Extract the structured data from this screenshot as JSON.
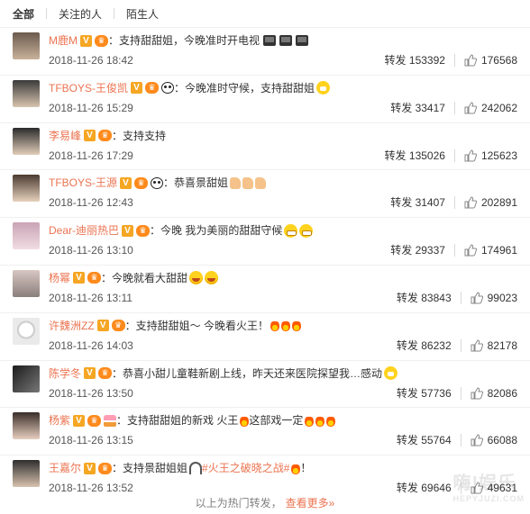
{
  "tabs": [
    "全部",
    "关注的人",
    "陌生人"
  ],
  "repost_label": "转发",
  "rows": [
    {
      "user": "M鹿M",
      "text": "：支持甜甜姐，今晚准时开电视",
      "time": "2018-11-26 18:42",
      "reposts": "153392",
      "likes": "176568"
    },
    {
      "user": "TFBOYS-王俊凯",
      "text": "：今晚准时守候，支持甜甜姐",
      "time": "2018-11-26 15:29",
      "reposts": "33417",
      "likes": "242062"
    },
    {
      "user": "李易峰",
      "text": "：支持支持",
      "time": "2018-11-26 17:29",
      "reposts": "135026",
      "likes": "125623"
    },
    {
      "user": "TFBOYS-王源",
      "text": "：恭喜景甜姐",
      "time": "2018-11-26 12:43",
      "reposts": "31407",
      "likes": "202891"
    },
    {
      "user": "Dear-迪丽热巴",
      "text": "：今晚 我为美丽的甜甜守候",
      "time": "2018-11-26 13:10",
      "reposts": "29337",
      "likes": "174961"
    },
    {
      "user": "杨幂",
      "text": "：今晚就看大甜甜",
      "time": "2018-11-26 13:11",
      "reposts": "83843",
      "likes": "99023"
    },
    {
      "user": "许魏洲ZZ",
      "text": "：支持甜甜姐～ 今晚看火王！",
      "time": "2018-11-26 14:03",
      "reposts": "86232",
      "likes": "82178"
    },
    {
      "user": "陈学冬",
      "text": "：恭喜小甜儿童鞋新剧上线，昨天还来医院探望我…感动",
      "time": "2018-11-26 13:50",
      "reposts": "57736",
      "likes": "82086"
    },
    {
      "user": "杨紫",
      "text": "：支持甜甜姐的新戏 火王",
      "text2": " 这部戏一定",
      "time": "2018-11-26 13:15",
      "reposts": "55764",
      "likes": "66088"
    },
    {
      "user": "王嘉尔",
      "text": "：支持景甜姐姐",
      "hashtag": "#火王之破晓之战#",
      "text2": "！",
      "time": "2018-11-26 13:52",
      "reposts": "69646",
      "likes": "49631"
    }
  ],
  "footer": {
    "text": "以上为热门转发，",
    "more": "查看更多»"
  },
  "watermark": {
    "main": "嗨!娱乐",
    "sub": "HEPYJUZI.COM"
  },
  "colors": {
    "accent": "#eb7350",
    "badge": "#f5a623"
  }
}
